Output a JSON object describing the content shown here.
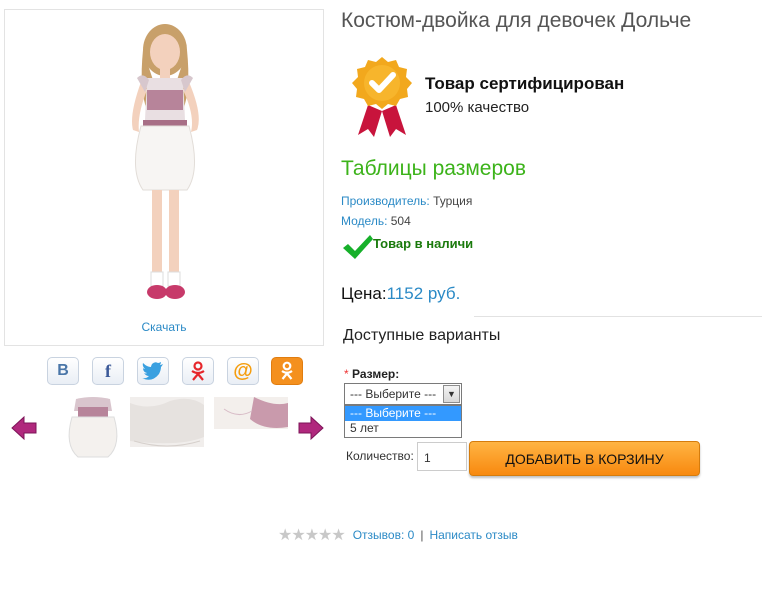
{
  "product": {
    "title": "Костюм-двойка для девочек Дольче",
    "download_label": "Скачать"
  },
  "share": {
    "icons": [
      "vk-icon",
      "facebook-icon",
      "twitter-icon",
      "odnoklassniki-icon",
      "mail-icon",
      "ok-icon"
    ]
  },
  "certificate": {
    "title": "Товар сертифицирован",
    "subtitle": "100% качество"
  },
  "sizes_link": "Таблицы размеров",
  "meta": {
    "manufacturer_label": "Производитель:",
    "manufacturer_value": "Турция",
    "model_label": "Модель:",
    "model_value": "504"
  },
  "stock": "Товар в наличи",
  "price": {
    "label": "Цена:",
    "amount": "1152 руб."
  },
  "options": {
    "heading": "Доступные варианты",
    "size_required_mark": "*",
    "size_label": "Размер:",
    "selected": "--- Выберите ---",
    "items": [
      "--- Выберите ---",
      "5 лет"
    ]
  },
  "quantity": {
    "label": "Количество:",
    "value": "1"
  },
  "cart_button": "ДОБАВИТЬ В КОРЗИНУ",
  "reviews": {
    "rating_stars": 0,
    "count_label": "Отзывов: 0",
    "separator": "|",
    "write_label": "Написать отзыв"
  },
  "colors": {
    "link": "#2b8ac6",
    "green": "#3cb31a",
    "cart_orange": "#f8890f",
    "badge_gold": "#f2a81d",
    "badge_red": "#c8143c"
  }
}
